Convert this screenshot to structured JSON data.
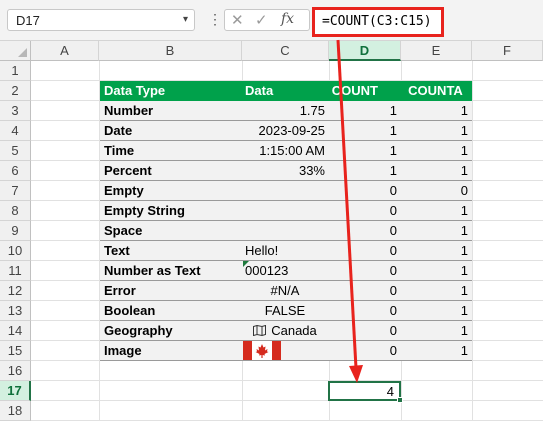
{
  "name_box": {
    "value": "D17"
  },
  "formula_bar": {
    "formula": "=COUNT(C3:C15)",
    "dots": "⋮",
    "fx": "fx"
  },
  "columns": [
    "A",
    "B",
    "C",
    "D",
    "E",
    "F"
  ],
  "rows": [
    "1",
    "2",
    "3",
    "4",
    "5",
    "6",
    "7",
    "8",
    "9",
    "10",
    "11",
    "12",
    "13",
    "14",
    "15",
    "16",
    "17",
    "18"
  ],
  "selected": {
    "column": "D",
    "row": "17",
    "value": "4"
  },
  "table": {
    "headers": [
      "Data Type",
      "Data",
      "COUNT",
      "COUNTA"
    ],
    "rows": [
      {
        "type": "Number",
        "data": "1.75",
        "count": "1",
        "counta": "1"
      },
      {
        "type": "Date",
        "data": "2023-09-25",
        "count": "1",
        "counta": "1"
      },
      {
        "type": "Time",
        "data": "1:15:00 AM",
        "count": "1",
        "counta": "1"
      },
      {
        "type": "Percent",
        "data": "33%",
        "count": "1",
        "counta": "1"
      },
      {
        "type": "Empty",
        "data": "",
        "count": "0",
        "counta": "0"
      },
      {
        "type": "Empty String",
        "data": "",
        "count": "0",
        "counta": "1"
      },
      {
        "type": "Space",
        "data": "",
        "count": "0",
        "counta": "1"
      },
      {
        "type": "Text",
        "data": "Hello!",
        "count": "0",
        "counta": "1"
      },
      {
        "type": "Number as Text",
        "data": "000123",
        "count": "0",
        "counta": "1"
      },
      {
        "type": "Error",
        "data": "#N/A",
        "count": "0",
        "counta": "1"
      },
      {
        "type": "Boolean",
        "data": "FALSE",
        "count": "0",
        "counta": "1"
      },
      {
        "type": "Geography",
        "data": "Canada",
        "count": "0",
        "counta": "1"
      },
      {
        "type": "Image",
        "data": "",
        "count": "0",
        "counta": "1"
      }
    ]
  },
  "colors": {
    "header_green": "#00a14b",
    "select_green": "#217346",
    "highlight_red": "#e8231d"
  },
  "icons": [
    "chevron-down-icon",
    "cancel-icon",
    "enter-icon",
    "fx-icon",
    "map-icon",
    "canada-flag-image"
  ]
}
